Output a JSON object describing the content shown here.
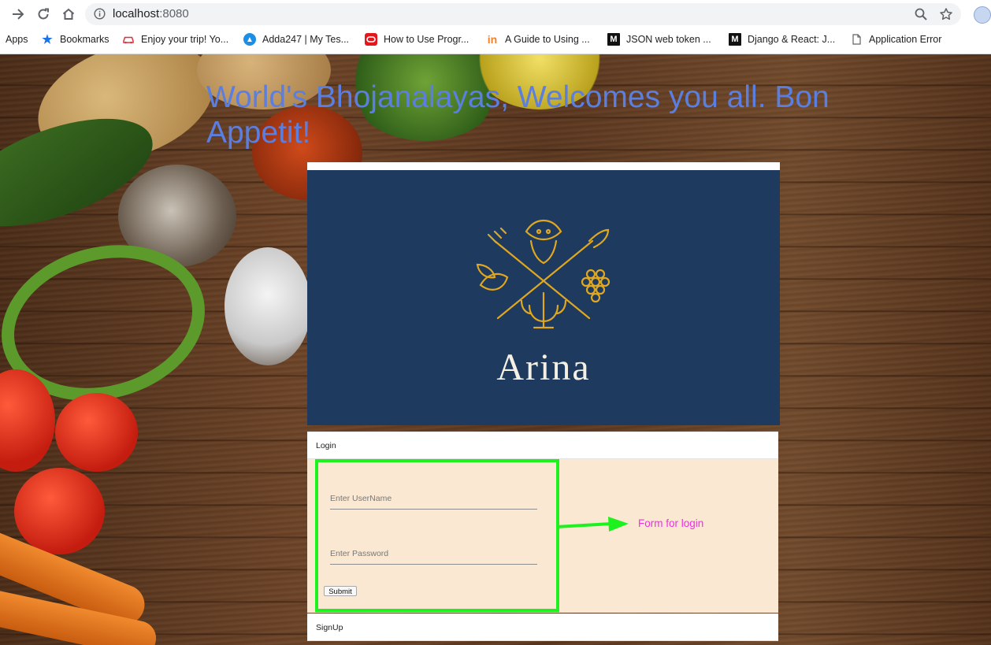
{
  "browser": {
    "url_host": "localhost",
    "url_port": ":8080",
    "bookmarks": [
      {
        "label": "Apps",
        "icon": "apps-icon"
      },
      {
        "label": "Bookmarks",
        "icon": "star-icon"
      },
      {
        "label": "Enjoy your trip! Yo...",
        "icon": "car-icon"
      },
      {
        "label": "Adda247 | My Tes...",
        "icon": "adda247-icon"
      },
      {
        "label": "How to Use Progr...",
        "icon": "oracle-icon"
      },
      {
        "label": "A Guide to Using ...",
        "icon": "invision-icon"
      },
      {
        "label": "JSON web token ...",
        "icon": "medium-icon"
      },
      {
        "label": "Django & React: J...",
        "icon": "medium-icon"
      },
      {
        "label": "Application Error",
        "icon": "page-icon"
      }
    ]
  },
  "page": {
    "welcome_text": "World's Bhojanalayas, Welcomes you all. Bon Appetit!",
    "brand_name": "Arina",
    "login_header": "Login",
    "username_placeholder": "Enter UserName",
    "password_placeholder": "Enter Password",
    "submit_label": "Submit",
    "annotation": "Form for login",
    "signup_header": "SignUp"
  },
  "colors": {
    "welcome_text": "#5b7fe0",
    "logo_background": "#1e3a5f",
    "logo_gold": "#e0a720",
    "form_background": "#fbe8d3",
    "annotation_green": "#1ef21e",
    "annotation_text": "#ee30e0"
  }
}
